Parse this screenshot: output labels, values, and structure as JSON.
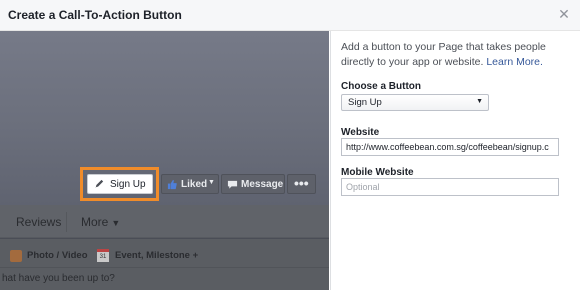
{
  "dialog": {
    "title": "Create a Call-To-Action Button",
    "close_icon": "close-icon"
  },
  "preview": {
    "cta_button_label": "Sign Up",
    "liked_label": "Liked",
    "message_label": "Message",
    "more_dots": "•••",
    "tabs": {
      "reviews": "Reviews",
      "more": "More"
    },
    "composer": {
      "photo_video": "Photo / Video",
      "event_milestone": "Event, Milestone +",
      "event_icon_number": "31",
      "prompt": "hat have you been up to?"
    }
  },
  "panel": {
    "intro_text": "Add a button to your Page that takes people directly to your app or website. ",
    "learn_more": "Learn More.",
    "choose_label": "Choose a Button",
    "choose_value": "Sign Up",
    "website_label": "Website",
    "website_value": "http://www.coffeebean.com.sg/coffeebean/signup.c",
    "mobile_label": "Mobile Website",
    "mobile_placeholder": "Optional"
  },
  "colors": {
    "highlight": "#f08c2a",
    "link": "#365899"
  }
}
